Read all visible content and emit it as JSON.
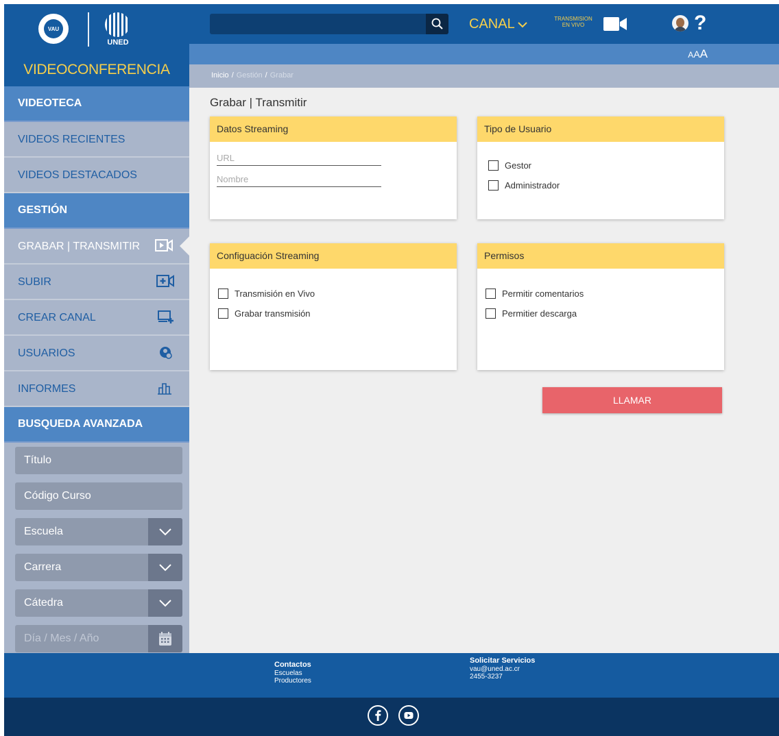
{
  "app": {
    "logo_vau_text": "VAU",
    "logo_uned_text": "UNED",
    "title": "VIDEOCONFERENCIA"
  },
  "topbar": {
    "search_placeholder": "",
    "canal_label": "CANAL",
    "transmision_label_1": "TRANSMISION",
    "transmision_label_2": "EN VIVO",
    "help_label": "?",
    "font_sizes": [
      "A",
      "A",
      "A"
    ]
  },
  "breadcrumb": {
    "items": [
      "Inicio",
      "Gestión",
      "Grabar"
    ]
  },
  "sidebar": {
    "videoteca_header": "VIDEOTECA",
    "videoteca_items": [
      "VIDEOS RECIENTES",
      "VIDEOS DESTACADOS"
    ],
    "gestion_header": "GESTIÓN",
    "gestion_items": [
      {
        "label": "GRABAR | TRANSMITIR",
        "icon": "video-record-icon",
        "active": true
      },
      {
        "label": "SUBIR",
        "icon": "upload-video-icon"
      },
      {
        "label": "CREAR CANAL",
        "icon": "add-channel-icon"
      },
      {
        "label": "USUARIOS",
        "icon": "users-settings-icon"
      },
      {
        "label": "INFORMES",
        "icon": "bar-chart-icon"
      }
    ],
    "busqueda_header": "BUSQUEDA AVANZADA",
    "search_fields": {
      "titulo": "Título",
      "codigo": "Código Curso",
      "escuela": "Escuela",
      "carrera": "Carrera",
      "catedra": "Cátedra",
      "fecha_placeholder": "Día / Mes / Año"
    }
  },
  "main": {
    "page_title": "Grabar | Transmitir",
    "datos_streaming": {
      "title": "Datos Streaming",
      "url_placeholder": "URL",
      "nombre_placeholder": "Nombre"
    },
    "tipo_usuario": {
      "title": "Tipo de Usuario",
      "options": [
        "Gestor",
        "Administrador"
      ]
    },
    "config_streaming": {
      "title": "Configuación Streaming",
      "options": [
        "Transmisión en Vivo",
        "Grabar transmisión"
      ]
    },
    "permisos": {
      "title": "Permisos",
      "options": [
        "Permitir comentarios",
        "Permitier descarga"
      ]
    },
    "llamar_label": "LLAMAR"
  },
  "footer": {
    "contactos_title": "Contactos",
    "contactos_links": [
      "Escuelas",
      "Productores"
    ],
    "servicios_title": "Solicitar Servicios",
    "email": "vau@uned.ac.cr",
    "phone": "2455-3237",
    "social": [
      "facebook-icon",
      "youtube-icon"
    ]
  },
  "colors": {
    "primary_blue": "#155ba0",
    "mid_blue": "#4e86c4",
    "sidebar_gray": "#a9b5ca",
    "accent_yellow": "#fed86b",
    "title_yellow": "#f6cf4b",
    "call_red": "#e8646a",
    "footer_dark": "#0b3461"
  }
}
